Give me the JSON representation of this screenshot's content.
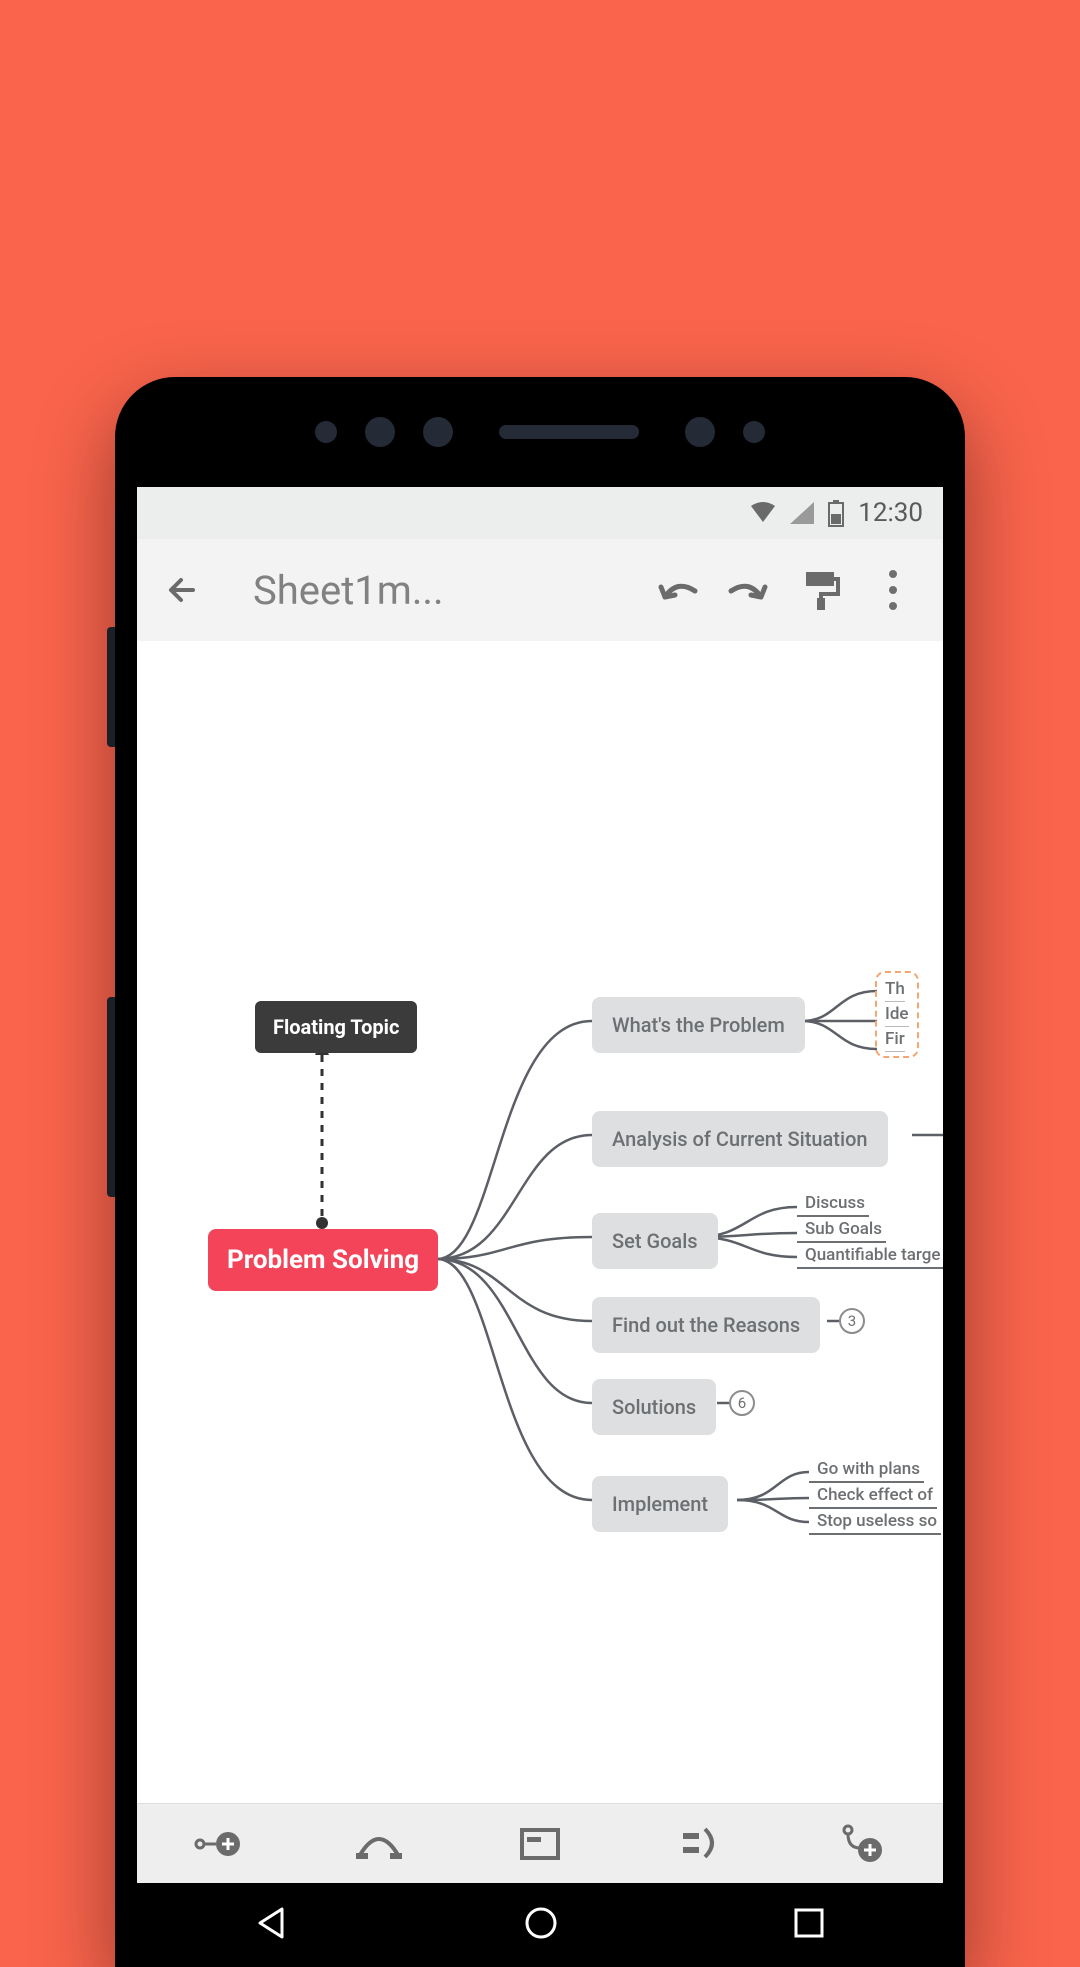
{
  "status": {
    "time": "12:30"
  },
  "appbar": {
    "title": "Sheet1m..."
  },
  "mindmap": {
    "root": "Problem Solving",
    "floating": "Floating Topic",
    "branches": {
      "b1": {
        "label": "What's the Problem",
        "leaves": [
          "Th",
          "Ide",
          "Fir"
        ]
      },
      "b2": {
        "label": "Analysis of Current Situation"
      },
      "b3": {
        "label": "Set Goals",
        "leaves": [
          "Discuss",
          "Sub Goals",
          "Quantifiable targe"
        ]
      },
      "b4": {
        "label": "Find out the Reasons",
        "count": "3"
      },
      "b5": {
        "label": "Solutions",
        "count": "6"
      },
      "b6": {
        "label": "Implement",
        "leaves": [
          "Go with plans",
          "Check effect of",
          "Stop useless so"
        ]
      }
    }
  }
}
